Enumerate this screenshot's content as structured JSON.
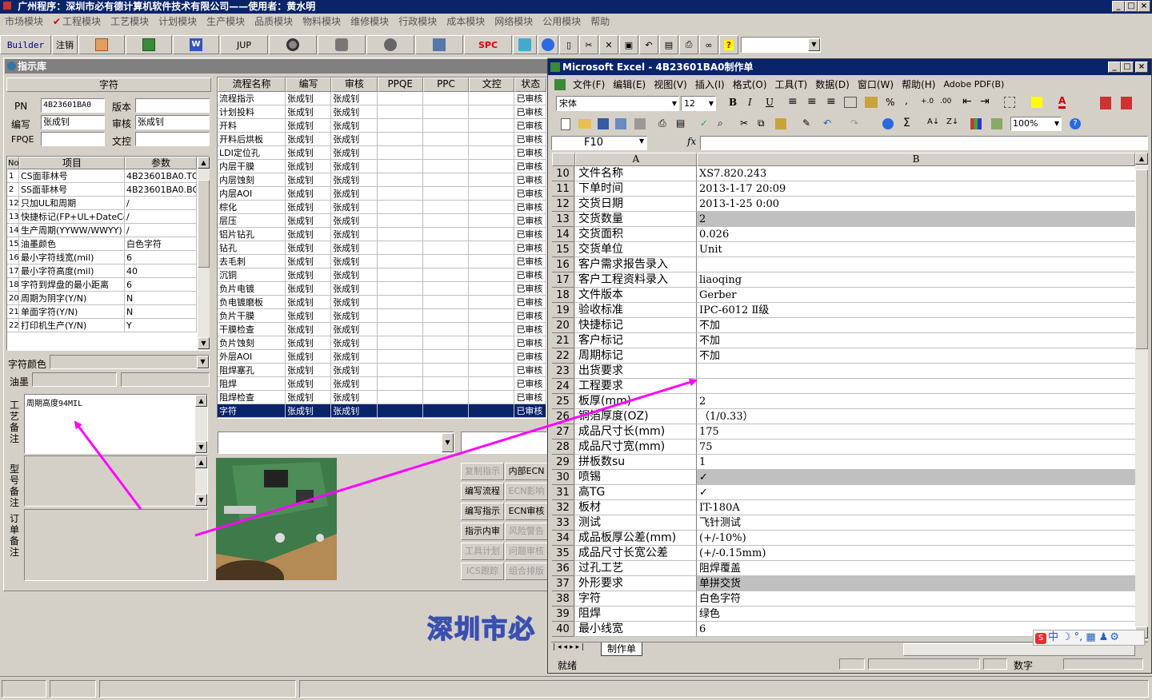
{
  "app": {
    "title": "广州程序：深圳市必有德计算机软件技术有限公司——使用者：黄水明",
    "window_controls": [
      "_",
      "□",
      "×"
    ]
  },
  "menu": [
    "市场模块",
    "工程模块",
    "工艺模块",
    "计划模块",
    "生产模块",
    "品质模块",
    "物料模块",
    "维修模块",
    "行政模块",
    "成本模块",
    "网络模块",
    "公用模块",
    "帮助"
  ],
  "toolbar": {
    "builder_label": "Builder",
    "logout_label": "注销",
    "jup_label": "JUP",
    "spc_label": "SPC"
  },
  "library": {
    "title": "指示库",
    "section_header": "字符",
    "pn_label": "PN",
    "pn_value": "4B23601BA0",
    "version_label": "版本",
    "version_value": "",
    "editor_label": "编写",
    "editor_value": "张成钊",
    "reviewer_label": "审核",
    "reviewer_value": "张成钊",
    "fpqe_label": "FPQE",
    "fpqe_value": "",
    "control_label": "文控",
    "control_value": "",
    "param_headers": [
      "No",
      "项目",
      "参数"
    ],
    "params": [
      {
        "no": "1",
        "item": "CS面菲林号",
        "value": "4B23601BA0.TO"
      },
      {
        "no": "2",
        "item": "SS面菲林号",
        "value": "4B23601BA0.BO"
      },
      {
        "no": "12",
        "item": "只加UL和周期",
        "value": "/"
      },
      {
        "no": "13",
        "item": "快捷标记(FP+UL+DateCo",
        "value": "/"
      },
      {
        "no": "14",
        "item": "生产周期(YYWW/WWYY)",
        "value": "/"
      },
      {
        "no": "15",
        "item": "油墨颜色",
        "value": "白色字符"
      },
      {
        "no": "16",
        "item": "最小字符线宽(mil)",
        "value": "6"
      },
      {
        "no": "17",
        "item": "最小字符高度(mil)",
        "value": "40"
      },
      {
        "no": "18",
        "item": "字符到焊盘的最小距离",
        "value": "6"
      },
      {
        "no": "20",
        "item": "周期为阴字(Y/N)",
        "value": "N"
      },
      {
        "no": "21",
        "item": "单面字符(Y/N)",
        "value": "N"
      },
      {
        "no": "22",
        "item": "打印机生产(Y/N)",
        "value": "Y"
      }
    ],
    "char_color_label": "字符颜色",
    "ink_label": "油墨",
    "process_note_label": "工艺备注",
    "process_note_value": "周期高度94MIL",
    "model_note_label": "型号备注",
    "order_note_label": "订单备注"
  },
  "flow": {
    "headers": [
      "流程名称",
      "编写",
      "审核",
      "PPQE",
      "PPC",
      "文控",
      "状态"
    ],
    "rows": [
      {
        "name": "流程指示",
        "editor": "张成钊",
        "reviewer": "张成钊",
        "status": "已审核"
      },
      {
        "name": "计划投料",
        "editor": "张成钊",
        "reviewer": "张成钊",
        "status": "已审核"
      },
      {
        "name": "开料",
        "editor": "张成钊",
        "reviewer": "张成钊",
        "status": "已审核"
      },
      {
        "name": "开料后烘板",
        "editor": "张成钊",
        "reviewer": "张成钊",
        "status": "已审核"
      },
      {
        "name": "LDI定位孔",
        "editor": "张成钊",
        "reviewer": "张成钊",
        "status": "已审核"
      },
      {
        "name": "内层干膜",
        "editor": "张成钊",
        "reviewer": "张成钊",
        "status": "已审核"
      },
      {
        "name": "内层蚀刻",
        "editor": "张成钊",
        "reviewer": "张成钊",
        "status": "已审核"
      },
      {
        "name": "内层AOI",
        "editor": "张成钊",
        "reviewer": "张成钊",
        "status": "已审核"
      },
      {
        "name": "棕化",
        "editor": "张成钊",
        "reviewer": "张成钊",
        "status": "已审核"
      },
      {
        "name": "层压",
        "editor": "张成钊",
        "reviewer": "张成钊",
        "status": "已审核"
      },
      {
        "name": "铝片钻孔",
        "editor": "张成钊",
        "reviewer": "张成钊",
        "status": "已审核"
      },
      {
        "name": "钻孔",
        "editor": "张成钊",
        "reviewer": "张成钊",
        "status": "已审核"
      },
      {
        "name": "去毛刺",
        "editor": "张成钊",
        "reviewer": "张成钊",
        "status": "已审核"
      },
      {
        "name": "沉铜",
        "editor": "张成钊",
        "reviewer": "张成钊",
        "status": "已审核"
      },
      {
        "name": "负片电镀",
        "editor": "张成钊",
        "reviewer": "张成钊",
        "status": "已审核"
      },
      {
        "name": "负电镀磨板",
        "editor": "张成钊",
        "reviewer": "张成钊",
        "status": "已审核"
      },
      {
        "name": "负片干膜",
        "editor": "张成钊",
        "reviewer": "张成钊",
        "status": "已审核"
      },
      {
        "name": "干膜检查",
        "editor": "张成钊",
        "reviewer": "张成钊",
        "status": "已审核"
      },
      {
        "name": "负片蚀刻",
        "editor": "张成钊",
        "reviewer": "张成钊",
        "status": "已审核"
      },
      {
        "name": "外层AOI",
        "editor": "张成钊",
        "reviewer": "张成钊",
        "status": "已审核"
      },
      {
        "name": "阻焊塞孔",
        "editor": "张成钊",
        "reviewer": "张成钊",
        "status": "已审核"
      },
      {
        "name": "阻焊",
        "editor": "张成钊",
        "reviewer": "张成钊",
        "status": "已审核"
      },
      {
        "name": "阻焊检查",
        "editor": "张成钊",
        "reviewer": "张成钊",
        "status": "已审核"
      },
      {
        "name": "字符",
        "editor": "张成钊",
        "reviewer": "张成钊",
        "status": "已审核"
      }
    ],
    "selected_index": 23
  },
  "action_buttons": [
    {
      "label": "复制指示",
      "enabled": false
    },
    {
      "label": "内部ECN",
      "enabled": true
    },
    {
      "label": "编写流程",
      "enabled": true
    },
    {
      "label": "ECN影响",
      "enabled": false
    },
    {
      "label": "编写指示",
      "enabled": true
    },
    {
      "label": "ECN审核",
      "enabled": true
    },
    {
      "label": "指示内审",
      "enabled": true
    },
    {
      "label": "风险警告",
      "enabled": false
    },
    {
      "label": "工具计划",
      "enabled": false
    },
    {
      "label": "问题审核",
      "enabled": false
    },
    {
      "label": "ICS跟踪",
      "enabled": false
    },
    {
      "label": "组合排版",
      "enabled": false
    }
  ],
  "watermark": "深圳市必",
  "excel": {
    "title": "Microsoft Excel - 4B23601BA0制作单",
    "menu": [
      "文件(F)",
      "编辑(E)",
      "视图(V)",
      "插入(I)",
      "格式(O)",
      "工具(T)",
      "数据(D)",
      "窗口(W)",
      "帮助(H)",
      "Adobe PDF(B)"
    ],
    "font_name": "宋体",
    "font_size": "12",
    "zoom": "100%",
    "name_box": "F10",
    "fx_label": "fx",
    "col_a": "A",
    "col_b": "B",
    "sheet_tab": "制作单",
    "status_ready": "就绪",
    "status_num": "数字",
    "ime_label": "中",
    "rows": [
      {
        "n": "10",
        "a": "文件名称",
        "b": "XS7.820.243",
        "grey": false
      },
      {
        "n": "11",
        "a": "下单时间",
        "b": "2013-1-17 20:09",
        "grey": false
      },
      {
        "n": "12",
        "a": "交货日期",
        "b": "2013-1-25 0:00",
        "grey": false
      },
      {
        "n": "13",
        "a": "交货数量",
        "b": "2",
        "grey": true
      },
      {
        "n": "14",
        "a": "交货面积",
        "b": "0.026",
        "grey": false
      },
      {
        "n": "15",
        "a": "交货单位",
        "b": "Unit",
        "grey": false
      },
      {
        "n": "16",
        "a": "客户需求报告录入",
        "b": "",
        "grey": false
      },
      {
        "n": "17",
        "a": "客户工程资料录入",
        "b": "liaoqing",
        "grey": false
      },
      {
        "n": "18",
        "a": "文件版本",
        "b": "Gerber",
        "grey": false
      },
      {
        "n": "19",
        "a": "验收标准",
        "b": "IPC-6012 Ⅱ级",
        "grey": false
      },
      {
        "n": "20",
        "a": "快捷标记",
        "b": "不加",
        "grey": false
      },
      {
        "n": "21",
        "a": "客户标记",
        "b": "不加",
        "grey": false
      },
      {
        "n": "22",
        "a": "周期标记",
        "b": "不加",
        "grey": false
      },
      {
        "n": "23",
        "a": "出货要求",
        "b": "",
        "grey": false
      },
      {
        "n": "24",
        "a": "工程要求",
        "b": "",
        "grey": false
      },
      {
        "n": "25",
        "a": "板厚(mm)",
        "b": "2",
        "grey": false
      },
      {
        "n": "26",
        "a": "铜箔厚度(OZ)",
        "b": "（1/0.33）",
        "grey": false
      },
      {
        "n": "27",
        "a": "成品尺寸长(mm)",
        "b": "175",
        "grey": false
      },
      {
        "n": "28",
        "a": "成品尺寸宽(mm)",
        "b": "75",
        "grey": false
      },
      {
        "n": "29",
        "a": "拼板数su",
        "b": "1",
        "grey": false
      },
      {
        "n": "30",
        "a": "喷锡",
        "b": "✓",
        "grey": true
      },
      {
        "n": "31",
        "a": "高TG",
        "b": "✓",
        "grey": false
      },
      {
        "n": "32",
        "a": "板材",
        "b": "IT-180A",
        "grey": false
      },
      {
        "n": "33",
        "a": "测试",
        "b": "飞针测试",
        "grey": false
      },
      {
        "n": "34",
        "a": "成品板厚公差(mm)",
        "b": "(+/-10%)",
        "grey": false
      },
      {
        "n": "35",
        "a": "成品尺寸长宽公差",
        "b": "(+/-0.15mm)",
        "grey": false
      },
      {
        "n": "36",
        "a": "过孔工艺",
        "b": "阻焊覆盖",
        "grey": false
      },
      {
        "n": "37",
        "a": "外形要求",
        "b": "单拼交货",
        "grey": true
      },
      {
        "n": "38",
        "a": "字符",
        "b": "白色字符",
        "grey": false
      },
      {
        "n": "39",
        "a": "阻焊",
        "b": "绿色",
        "grey": false
      },
      {
        "n": "40",
        "a": "最小线宽",
        "b": "6",
        "grey": false
      }
    ]
  },
  "colors": {
    "annotation": "#ff00ff",
    "titlebar": "#0a246a",
    "selected_row": "#0a246a"
  }
}
